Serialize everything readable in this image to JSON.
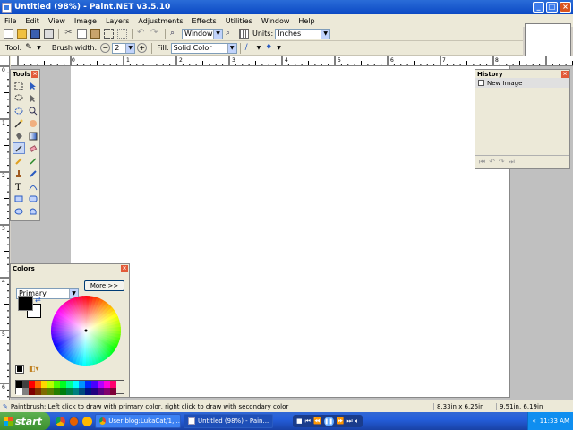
{
  "window": {
    "title": "Untitled (98%) - Paint.NET v3.5.10"
  },
  "menu": [
    "File",
    "Edit",
    "View",
    "Image",
    "Layers",
    "Adjustments",
    "Effects",
    "Utilities",
    "Window",
    "Help"
  ],
  "toolbar1": {
    "zoom_value": "Window",
    "units_label": "Units:",
    "units_value": "Inches"
  },
  "toolbar2": {
    "tool_label": "Tool:",
    "brush_width_label": "Brush width:",
    "brush_width_value": "2",
    "fill_label": "Fill:",
    "fill_value": "Solid Color"
  },
  "ruler": {
    "h_ticks": [
      "0",
      "1",
      "2",
      "3",
      "4",
      "5",
      "6",
      "7",
      "8"
    ],
    "v_ticks": [
      "0",
      "1",
      "2",
      "3",
      "4",
      "5",
      "6"
    ]
  },
  "tools_panel": {
    "title": "Tools"
  },
  "history_panel": {
    "title": "History",
    "items": [
      "New Image"
    ]
  },
  "colors_panel": {
    "title": "Colors",
    "mode_value": "Primary",
    "more_button": "More >>",
    "primary_color": "#000000",
    "secondary_color": "#ffffff"
  },
  "palette": [
    "#000000",
    "#404040",
    "#ff0000",
    "#ff6a00",
    "#ffd800",
    "#b6ff00",
    "#4cff00",
    "#00ff21",
    "#00ff90",
    "#00ffff",
    "#0094ff",
    "#0026ff",
    "#4800ff",
    "#b200ff",
    "#ff00dc",
    "#ff006e",
    "#ffffff",
    "#808080",
    "#7f0000",
    "#7f3300",
    "#7f6a00",
    "#5b7f00",
    "#267f00",
    "#007f0e",
    "#007f46",
    "#007f7f",
    "#004a7f",
    "#00137f",
    "#21007f",
    "#57007f",
    "#7f006e",
    "#7f0037"
  ],
  "status": {
    "hint": "Paintbrush: Left click to draw with primary color, right click to draw with secondary color",
    "image_size": "8.33in x 6.25in",
    "cursor_pos": "9.51in, 6.19in"
  },
  "taskbar": {
    "start_label": "start",
    "tasks": [
      "User blog:LukaCat/1,...",
      "Untitled (98%) - Pain..."
    ],
    "clock": "11:33 AM"
  }
}
